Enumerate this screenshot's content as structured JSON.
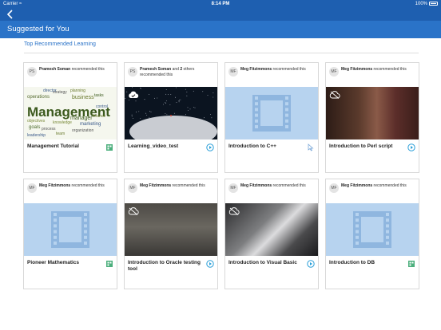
{
  "status_bar": {
    "carrier": "Carrier",
    "time": "8:14 PM",
    "battery": "100%"
  },
  "header": {
    "title": "Suggested for You"
  },
  "section": {
    "title": "Top Recommended Learning"
  },
  "cards": [
    {
      "initials": "PS",
      "recommender": "Pramesh Soman",
      "text": " recommended this",
      "title": "Management Tutorial",
      "thumb": "management-word-cloud",
      "type_icon": "course-icon"
    },
    {
      "initials": "PS",
      "recommender": "Pramesh Soman",
      "text": " and ",
      "others": "2",
      "text2": " others recommended this",
      "title": "Learning_video_test",
      "thumb": "night-sky",
      "type_icon": "play-icon",
      "badge": "downloaded-cloud-icon"
    },
    {
      "initials": "MF",
      "recommender": "Meg Fitzimmons",
      "text": " recommended this",
      "title": "Introduction to C++",
      "thumb": "placeholder",
      "type_icon": "cursor-icon"
    },
    {
      "initials": "MF",
      "recommender": "Meg Fitzimmons",
      "text": " recommended this",
      "title": "Introduction to Perl script",
      "thumb": "photo-girl",
      "type_icon": "play-icon",
      "badge": "offline-cloud-icon"
    },
    {
      "initials": "MF",
      "recommender": "Meg Fitzimmons",
      "text": " recommended this",
      "title": "Pioneer Mathematics",
      "thumb": "placeholder",
      "type_icon": "course-icon"
    },
    {
      "initials": "MF",
      "recommender": "Meg Fitzimmons",
      "text": " recommended this",
      "title": "Introduction to Oracle testing tool",
      "thumb": "photo-office",
      "type_icon": "play-icon",
      "badge": "offline-cloud-icon"
    },
    {
      "initials": "MF",
      "recommender": "Meg Fitzimmons",
      "text": " recommended this",
      "title": "Introduction to Visual Basic",
      "thumb": "photo-party",
      "type_icon": "play-icon",
      "badge": "offline-cloud-icon"
    },
    {
      "initials": "MF",
      "recommender": "Meg Fitzimmons",
      "text": " recommended this",
      "title": "Introduction to DB",
      "thumb": "placeholder",
      "type_icon": "course-icon"
    }
  ],
  "word_cloud": [
    "Management",
    "business",
    "operations",
    "marketing",
    "goals",
    "objectives",
    "strategy",
    "director",
    "planning",
    "manager",
    "organization",
    "control",
    "team",
    "leadership",
    "finance",
    "process",
    "tasks",
    "knowledge"
  ],
  "colors": {
    "header_dark": "#1e5fb0",
    "header": "#2a73c8",
    "accent": "#2a9fd8",
    "course_green": "#4caf7d"
  }
}
